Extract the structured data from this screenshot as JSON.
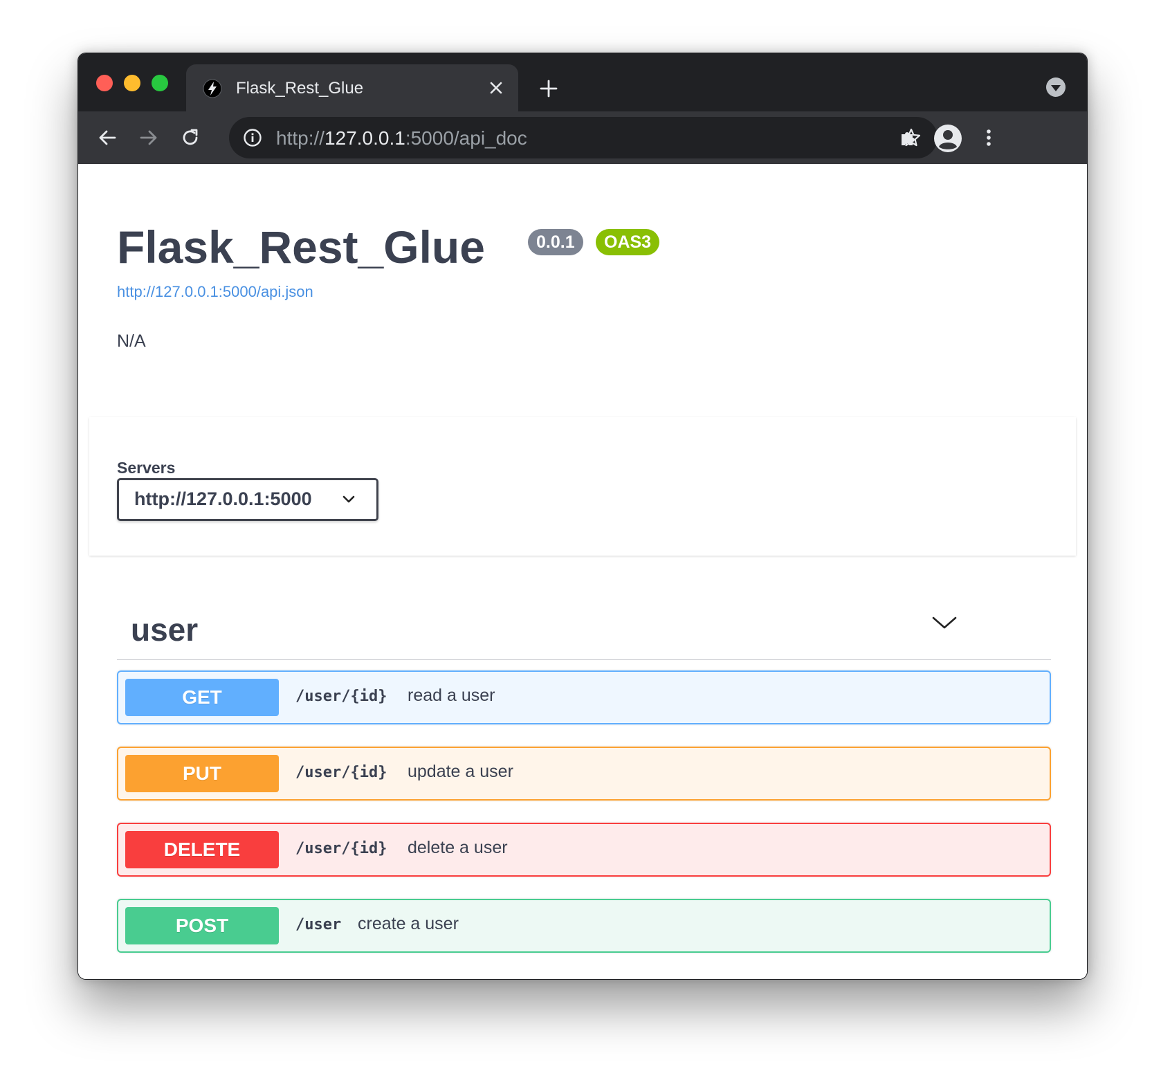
{
  "browser": {
    "tab_title": "Flask_Rest_Glue",
    "url_scheme": "http://",
    "url_host": "127.0.0.1",
    "url_rest": ":5000/api_doc"
  },
  "info": {
    "title": "Flask_Rest_Glue",
    "version": "0.0.1",
    "oas_badge": "OAS3",
    "spec_url": "http://127.0.0.1:5000/api.json",
    "description": "N/A"
  },
  "servers": {
    "label": "Servers",
    "selected": "http://127.0.0.1:5000"
  },
  "tag": {
    "name": "user",
    "operations": [
      {
        "method": "GET",
        "path": "/user/{id}",
        "summary": "read a user",
        "color": "#61affe",
        "bg": "#eff7ff"
      },
      {
        "method": "PUT",
        "path": "/user/{id}",
        "summary": "update a user",
        "color": "#fca130",
        "bg": "#fff5ea"
      },
      {
        "method": "DELETE",
        "path": "/user/{id}",
        "summary": "delete a user",
        "color": "#f93e3e",
        "bg": "#feebeb"
      },
      {
        "method": "POST",
        "path": "/user",
        "summary": "create a user",
        "color": "#49cc90",
        "bg": "#edf9f4"
      }
    ]
  },
  "colors": {
    "title_text": "#3b4151",
    "link": "#4990e2",
    "version_badge": "#7d8492",
    "oas_badge": "#89bf04"
  }
}
